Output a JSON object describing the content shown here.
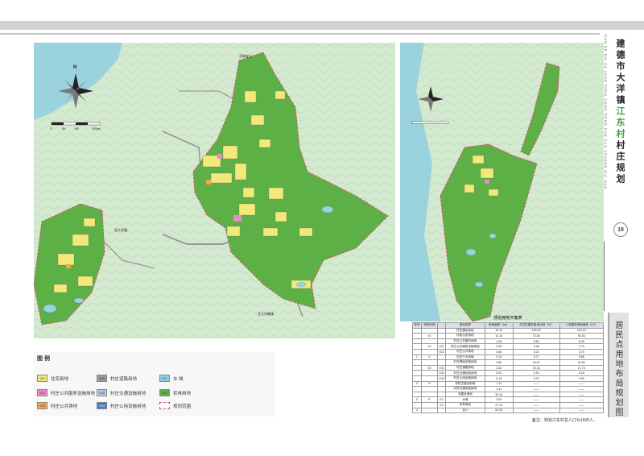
{
  "header": {
    "roman": "JIAN DE SHI DA YANG ZHEN JIANG DONG CUN CUN ZHUANG GUI HUA",
    "title_a": "建德市大洋镇",
    "title_b": "江东村",
    "title_c": "村庄规划",
    "page": "18",
    "subtitle": "居民点用地布局规划图"
  },
  "map_labels": {
    "north": "N",
    "scale": [
      "0",
      "50",
      "100",
      "200(m)"
    ],
    "place_1": "至新安江",
    "place_2": "至大洋集镇",
    "place_3": "至大洋镇"
  },
  "legend": {
    "title": "图 例",
    "items": [
      {
        "code": "V11",
        "label": "住宅用地",
        "color": "#f3e97a"
      },
      {
        "code": "V21",
        "label": "村庄公共服务设施用地",
        "color": "#e98ac6"
      },
      {
        "code": "V22",
        "label": "村庄公共场地",
        "color": "#f0a64c"
      },
      {
        "code": "V41",
        "label": "村庄道路用地",
        "color": "#9a9a9a"
      },
      {
        "code": "V42",
        "label": "村庄交通设施用地",
        "color": "#b3c8e4"
      },
      {
        "code": "V43",
        "label": "村庄公用设施用地",
        "color": "#3f7ec2"
      },
      {
        "code": "E1",
        "label": "水 域",
        "color": "#8fd0e2"
      },
      {
        "code": "E2",
        "label": "农林用地",
        "color": "#5cb046"
      },
      {
        "code": "",
        "label": "规划范围",
        "color": "#ffffff"
      }
    ]
  },
  "table": {
    "title": "规划用地平衡表",
    "headers": [
      "序号",
      "用地代码",
      "",
      "用地名称",
      "用地面积（ha）",
      "占村庄建设用地比例（%）",
      "人均建设用地面积（m²）"
    ],
    "rows": [
      [
        "",
        "",
        "",
        "村庄建设用地",
        "19.10",
        "100.00",
        "119.13"
      ],
      [
        "",
        "V1",
        "",
        "村民住宅用地",
        "14.10",
        "73.80",
        "90.53"
      ],
      [
        "",
        "",
        "",
        "村庄公共服务用地",
        "1.08",
        "5.62",
        "6.49"
      ],
      [
        "",
        "V2",
        "V21",
        "村庄公共服务设施用地",
        "0.45",
        "2.38",
        "2.79"
      ],
      [
        "",
        "",
        "V22",
        "村庄公共场地",
        "0.63",
        "3.23",
        "3.70"
      ],
      [
        "1",
        "V",
        "",
        "村庄产业用地",
        "0.14",
        "0.77",
        "0.86"
      ],
      [
        "",
        "",
        "",
        "村庄基础设施用地",
        "3.80",
        "19.87",
        "22.82"
      ],
      [
        "",
        "V4",
        "V41",
        "村庄道路用地",
        "3.63",
        "19.16",
        "21.74"
      ],
      [
        "",
        "",
        "V42",
        "村庄交通设施用地",
        "0.03",
        "0.16",
        "0.18"
      ],
      [
        "",
        "",
        "V43",
        "村庄公用设施用地",
        "0.15",
        "0.75",
        "0.90"
      ],
      [
        "2",
        "N",
        "",
        "非村庄建设用地",
        "1.11",
        "——",
        "——"
      ],
      [
        "",
        "",
        "",
        "对外交通设施用地",
        "1.11",
        "——",
        "——"
      ],
      [
        "",
        "",
        "",
        "非建设用地",
        "30.34",
        "——",
        "——"
      ],
      [
        "3",
        "E",
        "E1",
        "水域",
        "2.54",
        "——",
        "——"
      ],
      [
        "",
        "",
        "E2",
        "农林用地",
        "27.10",
        "——",
        "——"
      ],
      [
        "4",
        "",
        "",
        "合计",
        "51.33",
        "——",
        "——"
      ]
    ],
    "note": "备注：规划江东村总人口为1605人。"
  },
  "colors": {
    "green": "#5cb046",
    "yellow": "#f3e97a",
    "road": "#8a8a8a",
    "water": "#9ad2dd",
    "boundary": "#e24a6a"
  }
}
